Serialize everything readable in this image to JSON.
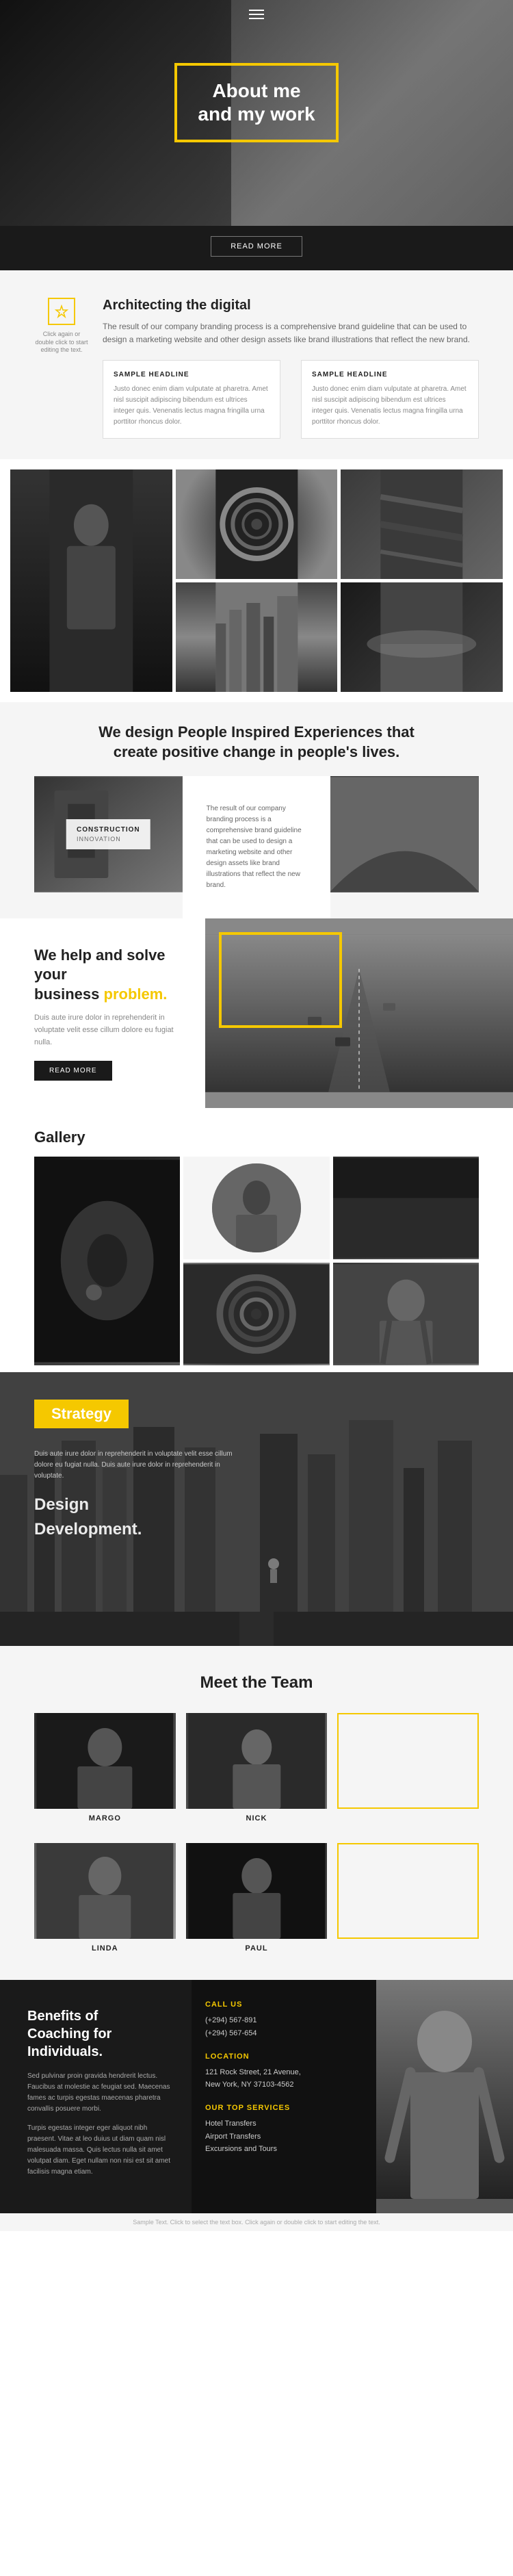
{
  "hero": {
    "title": "About me\nand my work",
    "menu_label": "Menu",
    "read_more": "READ MORE"
  },
  "arch": {
    "icon_label": "star-icon",
    "click_text": "Click again or double click to start editing the text.",
    "title": "Architecting the digital",
    "desc": "The result of our company branding process is a comprehensive brand guideline that can be used to design a marketing website and other design assets like brand illustrations that reflect the new brand.",
    "col1_title": "SAMPLE HEADLINE",
    "col1_text": "Justo donec enim diam vulputate at pharetra. Amet nisl suscipit adipiscing bibendum est ultrices integer quis. Venenatis lectus magna fringilla urna porttitor rhoncus dolor.",
    "col2_title": "SAMPLE HEADLINE",
    "col2_text": "Justo donec enim diam vulputate at pharetra. Amet nisl suscipit adipiscing bibendum est ultrices integer quis. Venenatis lectus magna fringilla urna porttitor rhoncus dolor."
  },
  "people": {
    "title": "We design People Inspired Experiences that\ncreate positive change in people's lives.",
    "overlay_title": "CONSTRUCTION",
    "overlay_sub": "INNOVATION",
    "right_text": "The result of our company branding process is a comprehensive brand guideline that can be used to design a marketing website and other design assets like brand illustrations that reflect the new brand."
  },
  "business": {
    "title_line1": "We help and solve your",
    "title_line2": "business",
    "highlight": "problem.",
    "desc": "Duis aute irure dolor in reprehenderit in voluptate velit esse cillum dolore eu fugiat nulla.",
    "read_more": "READ MORE"
  },
  "gallery": {
    "title": "Gallery"
  },
  "strategy": {
    "title": "Strategy",
    "text": "Duis aute irure dolor in reprehenderit in voluptate velit esse cillum dolore eu fugiat nulla. Duis aute irure dolor in reprehenderit in voluptate.",
    "item1": "Design",
    "item2": "Development."
  },
  "team": {
    "title": "Meet the Team",
    "members": [
      {
        "name": "MARGO"
      },
      {
        "name": "NICK"
      },
      {
        "name": ""
      }
    ],
    "members2": [
      {
        "name": "LINDA"
      },
      {
        "name": "PAUL"
      },
      {
        "name": ""
      }
    ]
  },
  "contact": {
    "title": "Benefits of\nCoaching for\nIndividuals.",
    "desc1": "Sed pulvinar proin gravida hendrerit lectus. Faucibus at molestie ac feugiat sed. Maecenas fames ac turpis egestas maecenas pharetra convallis posuere morbi.",
    "desc2": "Turpis egestas integer eger aliquot nibh praesent. Vitae at leo duius ut diam quam nisl malesuada massa. Quis lectus nulla sit amet volutpat diam. Eget nullam non nisi est sit amet facilisis magna etiam.",
    "call_title": "CALL US",
    "call_num1": "(+294) 567-891",
    "call_num2": "(+294) 567-654",
    "location_title": "LOCATION",
    "location_text": "121 Rock Street, 21 Avenue,\nNew York, NY 37103-4562",
    "services_title": "OUR TOP SERVICES",
    "services": "Hotel Transfers\nAirport Transfers\nExcursions and Tours"
  },
  "footer": {
    "text": "Sample Text. Click to select the text box. Click again or double click to start editing the text."
  }
}
